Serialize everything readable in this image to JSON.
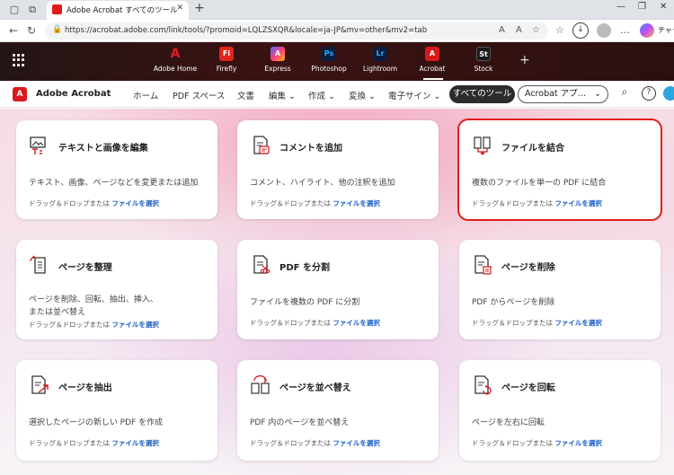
{
  "browser": {
    "tab_title": "Adobe Acrobat すべてのツール",
    "url": "https://acrobat.adobe.com/link/tools/?promoid=LQLZSXQR&locale=ja-JP&mv=other&mv2=tab",
    "copilot_label": "チャッ"
  },
  "apps": [
    {
      "label": "Adobe Home",
      "tile": "A",
      "color": "#e21d1d"
    },
    {
      "label": "Firefly",
      "tile": "Fi",
      "color": "#e1251b"
    },
    {
      "label": "Express",
      "tile": "A",
      "color": "#1a1a2e"
    },
    {
      "label": "Photoshop",
      "tile": "Ps",
      "color": "#0d1f3c"
    },
    {
      "label": "Lightroom",
      "tile": "Lr",
      "color": "#0d1f3c"
    },
    {
      "label": "Acrobat",
      "tile": "A",
      "color": "#d7191d"
    },
    {
      "label": "Stock",
      "tile": "St",
      "color": "#1a1a1a"
    }
  ],
  "acrobat_nav": {
    "product": "Adobe Acrobat",
    "items": [
      "ホーム",
      "PDF スペース",
      "文書",
      "編集 ⌄",
      "作成 ⌄",
      "変換 ⌄",
      "電子サイン ⌄"
    ],
    "all_tools": "すべてのツール",
    "ai_dropdown": "Acrobat アプ…"
  },
  "cards": [
    {
      "title": "テキストと画像を編集",
      "desc": "テキスト、画像、ページなどを変更または追加",
      "dd_prefix": "ドラッグ＆ドロップまたは",
      "dd_link": "ファイルを選択"
    },
    {
      "title": "コメントを追加",
      "desc": "コメント、ハイライト、他の注釈を追加",
      "dd_prefix": "ドラッグ＆ドロップまたは",
      "dd_link": "ファイルを選択"
    },
    {
      "title": "ファイルを結合",
      "desc": "複数のファイルを単一の PDF に結合",
      "dd_prefix": "ドラッグ＆ドロップまたは",
      "dd_link": "ファイルを選択"
    },
    {
      "title": "ページを整理",
      "desc": "ページを削除、回転、抽出、挿入、\nまたは並べ替え",
      "dd_prefix": "ドラッグ＆ドロップまたは",
      "dd_link": "ファイルを選択"
    },
    {
      "title": "PDF を分割",
      "desc": "ファイルを複数の PDF に分割",
      "dd_prefix": "ドラッグ＆ドロップまたは",
      "dd_link": "ファイルを選択"
    },
    {
      "title": "ページを削除",
      "desc": "PDF からページを削除",
      "dd_prefix": "ドラッグ＆ドロップまたは",
      "dd_link": "ファイルを選択"
    },
    {
      "title": "ページを抽出",
      "desc": "選択したページの新しい PDF を作成",
      "dd_prefix": "ドラッグ＆ドロップまたは",
      "dd_link": "ファイルを選択"
    },
    {
      "title": "ページを並べ替え",
      "desc": "PDF 内のページを並べ替え",
      "dd_prefix": "ドラッグ＆ドロップまたは",
      "dd_link": "ファイルを選択"
    },
    {
      "title": "ページを回転",
      "desc": "ページを左右に回転",
      "dd_prefix": "ドラッグ＆ドロップまたは",
      "dd_link": "ファイルを選択"
    }
  ]
}
